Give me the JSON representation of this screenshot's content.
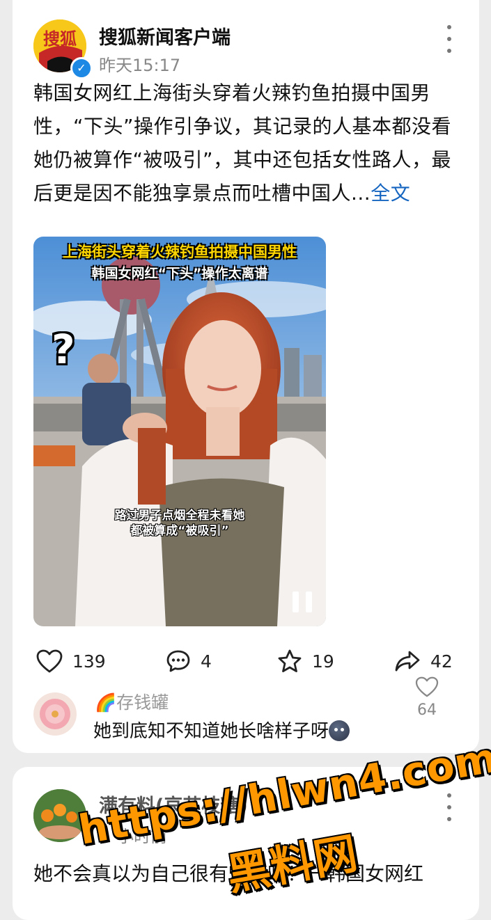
{
  "post": {
    "author": "搜狐新闻客户端",
    "avatar_text": "搜狐",
    "time": "昨天15:17",
    "text": "韩国女网红上海街头穿着火辣钓鱼拍摄中国男性，“下头”操作引争议，其记录的人基本都没看她仍被算作“被吸引”，其中还包括女性路人，最后更是因不能独享景点而吐槽中国人...",
    "full_link": "全文",
    "video": {
      "title_line1": "上海街头穿着火辣钓鱼拍摄中国男性",
      "title_line2": "韩国女网红“下头”操作太离谱",
      "question_mark": "?",
      "caption_line1": "路过男子点烟全程未看她",
      "caption_line2": "都被算成“被吸引”"
    },
    "actions": {
      "likes": "139",
      "comments": "4",
      "favorites": "19",
      "shares": "42"
    },
    "top_comment": {
      "user_emoji": "🌈",
      "user": "存钱罐",
      "text": "她到底知不知道她长啥样子呀",
      "likes": "64"
    }
  },
  "next_post": {
    "author": "满有料(哀艾枝糖)",
    "time": "小时前",
    "text": "她不会真以为自己很有魅力吧！一韩国女网红"
  },
  "watermark": {
    "url": "https://hlwn4.com",
    "name": "黑料网"
  },
  "colors": {
    "background": "#ececec",
    "link": "#1565c0",
    "verified": "#1e88e5",
    "watermark": "#ff9800"
  }
}
